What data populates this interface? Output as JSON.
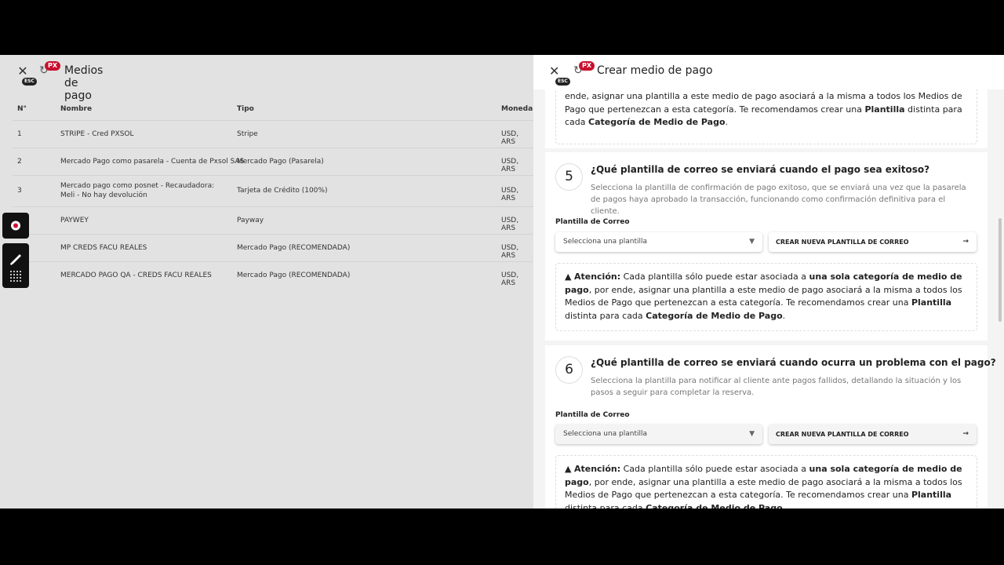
{
  "left": {
    "title": "Medios de pago",
    "esc": "ESC",
    "badge": "PX",
    "table": {
      "headers": [
        "N°",
        "Nombre",
        "Tipo",
        "Moneda"
      ],
      "rows": [
        {
          "n": "1",
          "nombre": "STRIPE - Cred PXSOL",
          "tipo": "Stripe",
          "moneda": "USD, ARS"
        },
        {
          "n": "2",
          "nombre": "Mercado Pago como pasarela - Cuenta de Pxsol SAS",
          "tipo": "Mercado Pago (Pasarela)",
          "moneda": "USD, ARS"
        },
        {
          "n": "3",
          "nombre": "Mercado pago como posnet - Recaudadora: Meli - No hay devolución",
          "tipo": "Tarjeta de Crédito (100%)",
          "moneda": "USD, ARS"
        },
        {
          "n": "",
          "nombre": "PAYWEY",
          "tipo": "Payway",
          "moneda": "USD, ARS"
        },
        {
          "n": "",
          "nombre": "MP CREDS FACU REALES",
          "tipo": "Mercado Pago (RECOMENDADA)",
          "moneda": "USD, ARS"
        },
        {
          "n": "",
          "nombre": "MERCADO PAGO QA - CREDS FACU REALES",
          "tipo": "Mercado Pago (RECOMENDADA)",
          "moneda": "USD, ARS"
        }
      ]
    }
  },
  "right": {
    "title": "Crear medio de pago",
    "esc": "ESC",
    "badge": "PX",
    "warning": {
      "label": "Atención:",
      "t1": " Cada plantilla sólo puede estar asociada a ",
      "b1": "una sola categoría de medio de pago",
      "t2": ", por ende, asignar una plantilla a este medio de pago asociará a la misma a todos los Medios de Pago que pertenezcan a esta categoría. Te recomendamos crear una ",
      "b2": "Plantilla",
      "t3": " distinta para cada ",
      "b3": "Categoría de Medio de Pago",
      "t4": "."
    },
    "top_fragment": {
      "t2": "ende, asignar una plantilla a este medio de pago asociará a la misma a todos los Medios de Pago que pertenezcan a esta categoría. Te recomendamos crear una ",
      "b2": "Plantilla",
      "t3": " distinta para cada ",
      "b3": "Categoría de Medio de Pago",
      "t4": "."
    },
    "sections": [
      {
        "number": "5",
        "question": "¿Qué plantilla de correo se enviará cuando el pago sea exitoso?",
        "description": "Selecciona la plantilla de confirmación de pago exitoso, que se enviará una vez que la pasarela de pagos haya aprobado la transacción, funcionando como confirmación definitiva para el cliente.",
        "field_label": "Plantilla de Correo",
        "select_placeholder": "Selecciona una plantilla",
        "button_label": "CREAR NUEVA PLANTILLA DE CORREO"
      },
      {
        "number": "6",
        "question": "¿Qué plantilla de correo se enviará cuando ocurra un problema con el pago?",
        "description": "Selecciona la plantilla para notificar al cliente ante pagos fallidos, detallando la situación y los pasos a seguir para completar la reserva.",
        "field_label": "Plantilla de Correo",
        "select_placeholder": "Selecciona una plantilla",
        "button_label": "CREAR NUEVA PLANTILLA DE CORREO"
      }
    ]
  }
}
